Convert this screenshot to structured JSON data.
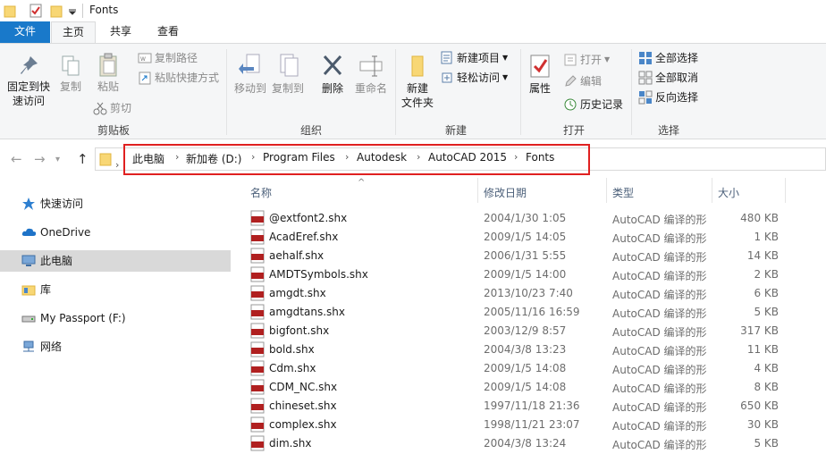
{
  "window": {
    "title": "Fonts"
  },
  "tabs": {
    "file": "文件",
    "home": "主页",
    "share": "共享",
    "view": "查看"
  },
  "ribbon": {
    "clipboard": {
      "label": "剪贴板",
      "pin": "固定到快速访问",
      "pin_line1": "固定到快",
      "pin_line2": "速访问",
      "copy": "复制",
      "paste": "粘贴",
      "copy_path": "复制路径",
      "paste_shortcut": "粘贴快捷方式",
      "cut": "剪切"
    },
    "organize": {
      "label": "组织",
      "move_to": "移动到",
      "copy_to": "复制到",
      "delete": "删除",
      "rename": "重命名"
    },
    "new": {
      "label": "新建",
      "new_folder_line1": "新建",
      "new_folder_line2": "文件夹",
      "new_item": "新建项目",
      "easy_access": "轻松访问"
    },
    "open": {
      "label": "打开",
      "properties": "属性",
      "open": "打开",
      "edit": "编辑",
      "history": "历史记录"
    },
    "select": {
      "label": "选择",
      "select_all": "全部选择",
      "select_none": "全部取消",
      "invert": "反向选择"
    }
  },
  "breadcrumb": [
    "此电脑",
    "新加卷 (D:)",
    "Program Files",
    "Autodesk",
    "AutoCAD 2015",
    "Fonts"
  ],
  "nav_pane": [
    {
      "label": "快速访问",
      "icon": "star-icon"
    },
    {
      "label": "OneDrive",
      "icon": "cloud-icon"
    },
    {
      "label": "此电脑",
      "icon": "computer-icon",
      "selected": true
    },
    {
      "label": "库",
      "icon": "library-icon"
    },
    {
      "label": "My Passport (F:)",
      "icon": "drive-icon"
    },
    {
      "label": "网络",
      "icon": "network-icon"
    }
  ],
  "columns": {
    "name": "名称",
    "date": "修改日期",
    "type": "类型",
    "size": "大小"
  },
  "files": [
    {
      "name": "@extfont2.shx",
      "date": "2004/1/30 1:05",
      "type": "AutoCAD 编译的形",
      "size": "480 KB"
    },
    {
      "name": "AcadEref.shx",
      "date": "2009/1/5 14:05",
      "type": "AutoCAD 编译的形",
      "size": "1 KB"
    },
    {
      "name": "aehalf.shx",
      "date": "2006/1/31 5:55",
      "type": "AutoCAD 编译的形",
      "size": "14 KB"
    },
    {
      "name": "AMDTSymbols.shx",
      "date": "2009/1/5 14:00",
      "type": "AutoCAD 编译的形",
      "size": "2 KB"
    },
    {
      "name": "amgdt.shx",
      "date": "2013/10/23 7:40",
      "type": "AutoCAD 编译的形",
      "size": "6 KB"
    },
    {
      "name": "amgdtans.shx",
      "date": "2005/11/16 16:59",
      "type": "AutoCAD 编译的形",
      "size": "5 KB"
    },
    {
      "name": "bigfont.shx",
      "date": "2003/12/9 8:57",
      "type": "AutoCAD 编译的形",
      "size": "317 KB"
    },
    {
      "name": "bold.shx",
      "date": "2004/3/8 13:23",
      "type": "AutoCAD 编译的形",
      "size": "11 KB"
    },
    {
      "name": "Cdm.shx",
      "date": "2009/1/5 14:08",
      "type": "AutoCAD 编译的形",
      "size": "4 KB"
    },
    {
      "name": "CDM_NC.shx",
      "date": "2009/1/5 14:08",
      "type": "AutoCAD 编译的形",
      "size": "8 KB"
    },
    {
      "name": "chineset.shx",
      "date": "1997/11/18 21:36",
      "type": "AutoCAD 编译的形",
      "size": "650 KB"
    },
    {
      "name": "complex.shx",
      "date": "1998/11/21 23:07",
      "type": "AutoCAD 编译的形",
      "size": "30 KB"
    },
    {
      "name": "dim.shx",
      "date": "2004/3/8 13:24",
      "type": "AutoCAD 编译的形",
      "size": "5 KB"
    }
  ],
  "colors": {
    "accent": "#1979ca",
    "highlight_box": "#e02020",
    "file_icon": "#b02020"
  }
}
